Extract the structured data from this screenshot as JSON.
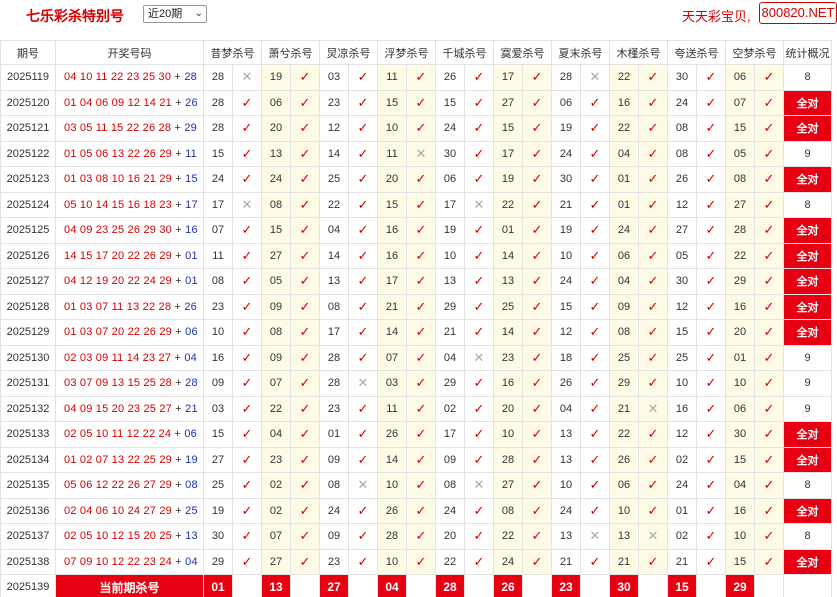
{
  "header": {
    "title": "七乐彩杀特别号",
    "select_value": "近20期",
    "brand_text": "天天彩宝贝,",
    "brand_site": "800820.NET"
  },
  "columns": [
    "期号",
    "开奖号码",
    "昔梦杀号",
    "萧兮杀号",
    "炅凉杀号",
    "浮梦杀号",
    "千城杀号",
    "寞爱杀号",
    "夏末杀号",
    "木槿杀号",
    "夸送杀号",
    "空梦杀号",
    "统计概况"
  ],
  "rows": [
    {
      "period": "2025119",
      "draw": "04 10 11 22 23 25 30",
      "special": "28",
      "kills": [
        [
          "28",
          "x"
        ],
        [
          "19",
          "v"
        ],
        [
          "03",
          "v"
        ],
        [
          "11",
          "v"
        ],
        [
          "26",
          "v"
        ],
        [
          "17",
          "v"
        ],
        [
          "28",
          "x"
        ],
        [
          "22",
          "v"
        ],
        [
          "30",
          "v"
        ],
        [
          "06",
          "v"
        ]
      ],
      "stat": "8"
    },
    {
      "period": "2025120",
      "draw": "01 04 06 09 12 14 21",
      "special": "26",
      "kills": [
        [
          "28",
          "v"
        ],
        [
          "06",
          "v"
        ],
        [
          "23",
          "v"
        ],
        [
          "15",
          "v"
        ],
        [
          "15",
          "v"
        ],
        [
          "27",
          "v"
        ],
        [
          "06",
          "v"
        ],
        [
          "16",
          "v"
        ],
        [
          "24",
          "v"
        ],
        [
          "07",
          "v"
        ]
      ],
      "stat": "全对"
    },
    {
      "period": "2025121",
      "draw": "03 05 11 15 22 26 28",
      "special": "29",
      "kills": [
        [
          "28",
          "v"
        ],
        [
          "20",
          "v"
        ],
        [
          "12",
          "v"
        ],
        [
          "10",
          "v"
        ],
        [
          "24",
          "v"
        ],
        [
          "15",
          "v"
        ],
        [
          "19",
          "v"
        ],
        [
          "22",
          "v"
        ],
        [
          "08",
          "v"
        ],
        [
          "15",
          "v"
        ]
      ],
      "stat": "全对"
    },
    {
      "period": "2025122",
      "draw": "01 05 06 13 22 26 29",
      "special": "11",
      "kills": [
        [
          "15",
          "v"
        ],
        [
          "13",
          "v"
        ],
        [
          "14",
          "v"
        ],
        [
          "11",
          "x"
        ],
        [
          "30",
          "v"
        ],
        [
          "17",
          "v"
        ],
        [
          "24",
          "v"
        ],
        [
          "04",
          "v"
        ],
        [
          "08",
          "v"
        ],
        [
          "05",
          "v"
        ]
      ],
      "stat": "9"
    },
    {
      "period": "2025123",
      "draw": "01 03 08 10 16 21 29",
      "special": "15",
      "kills": [
        [
          "24",
          "v"
        ],
        [
          "24",
          "v"
        ],
        [
          "25",
          "v"
        ],
        [
          "20",
          "v"
        ],
        [
          "06",
          "v"
        ],
        [
          "19",
          "v"
        ],
        [
          "30",
          "v"
        ],
        [
          "01",
          "v"
        ],
        [
          "26",
          "v"
        ],
        [
          "08",
          "v"
        ]
      ],
      "stat": "全对"
    },
    {
      "period": "2025124",
      "draw": "05 10 14 15 16 18 23",
      "special": "17",
      "kills": [
        [
          "17",
          "x"
        ],
        [
          "08",
          "v"
        ],
        [
          "22",
          "v"
        ],
        [
          "15",
          "v"
        ],
        [
          "17",
          "x"
        ],
        [
          "22",
          "v"
        ],
        [
          "21",
          "v"
        ],
        [
          "01",
          "v"
        ],
        [
          "12",
          "v"
        ],
        [
          "27",
          "v"
        ]
      ],
      "stat": "8"
    },
    {
      "period": "2025125",
      "draw": "04 09 23 25 26 29 30",
      "special": "16",
      "kills": [
        [
          "07",
          "v"
        ],
        [
          "15",
          "v"
        ],
        [
          "04",
          "v"
        ],
        [
          "16",
          "v"
        ],
        [
          "19",
          "v"
        ],
        [
          "01",
          "v"
        ],
        [
          "19",
          "v"
        ],
        [
          "24",
          "v"
        ],
        [
          "27",
          "v"
        ],
        [
          "28",
          "v"
        ]
      ],
      "stat": "全对"
    },
    {
      "period": "2025126",
      "draw": "14 15 17 20 22 26 29",
      "special": "01",
      "kills": [
        [
          "11",
          "v"
        ],
        [
          "27",
          "v"
        ],
        [
          "14",
          "v"
        ],
        [
          "16",
          "v"
        ],
        [
          "10",
          "v"
        ],
        [
          "14",
          "v"
        ],
        [
          "10",
          "v"
        ],
        [
          "06",
          "v"
        ],
        [
          "05",
          "v"
        ],
        [
          "22",
          "v"
        ]
      ],
      "stat": "全对"
    },
    {
      "period": "2025127",
      "draw": "04 12 19 20 22 24 29",
      "special": "01",
      "kills": [
        [
          "08",
          "v"
        ],
        [
          "05",
          "v"
        ],
        [
          "13",
          "v"
        ],
        [
          "17",
          "v"
        ],
        [
          "13",
          "v"
        ],
        [
          "13",
          "v"
        ],
        [
          "24",
          "v"
        ],
        [
          "04",
          "v"
        ],
        [
          "30",
          "v"
        ],
        [
          "29",
          "v"
        ]
      ],
      "stat": "全对"
    },
    {
      "period": "2025128",
      "draw": "01 03 07 11 13 22 28",
      "special": "26",
      "kills": [
        [
          "23",
          "v"
        ],
        [
          "09",
          "v"
        ],
        [
          "08",
          "v"
        ],
        [
          "21",
          "v"
        ],
        [
          "29",
          "v"
        ],
        [
          "25",
          "v"
        ],
        [
          "15",
          "v"
        ],
        [
          "09",
          "v"
        ],
        [
          "12",
          "v"
        ],
        [
          "16",
          "v"
        ]
      ],
      "stat": "全对"
    },
    {
      "period": "2025129",
      "draw": "01 03 07 20 22 26 29",
      "special": "06",
      "kills": [
        [
          "10",
          "v"
        ],
        [
          "08",
          "v"
        ],
        [
          "17",
          "v"
        ],
        [
          "14",
          "v"
        ],
        [
          "21",
          "v"
        ],
        [
          "14",
          "v"
        ],
        [
          "12",
          "v"
        ],
        [
          "08",
          "v"
        ],
        [
          "15",
          "v"
        ],
        [
          "20",
          "v"
        ]
      ],
      "stat": "全对"
    },
    {
      "period": "2025130",
      "draw": "02 03 09 11 14 23 27",
      "special": "04",
      "kills": [
        [
          "16",
          "v"
        ],
        [
          "09",
          "v"
        ],
        [
          "28",
          "v"
        ],
        [
          "07",
          "v"
        ],
        [
          "04",
          "x"
        ],
        [
          "23",
          "v"
        ],
        [
          "18",
          "v"
        ],
        [
          "25",
          "v"
        ],
        [
          "25",
          "v"
        ],
        [
          "01",
          "v"
        ]
      ],
      "stat": "9"
    },
    {
      "period": "2025131",
      "draw": "03 07 09 13 15 25 28",
      "special": "28",
      "kills": [
        [
          "09",
          "v"
        ],
        [
          "07",
          "v"
        ],
        [
          "28",
          "x"
        ],
        [
          "03",
          "v"
        ],
        [
          "29",
          "v"
        ],
        [
          "16",
          "v"
        ],
        [
          "26",
          "v"
        ],
        [
          "29",
          "v"
        ],
        [
          "10",
          "v"
        ],
        [
          "10",
          "v"
        ]
      ],
      "stat": "9"
    },
    {
      "period": "2025132",
      "draw": "04 09 15 20 23 25 27",
      "special": "21",
      "kills": [
        [
          "03",
          "v"
        ],
        [
          "22",
          "v"
        ],
        [
          "23",
          "v"
        ],
        [
          "11",
          "v"
        ],
        [
          "02",
          "v"
        ],
        [
          "20",
          "v"
        ],
        [
          "04",
          "v"
        ],
        [
          "21",
          "x"
        ],
        [
          "16",
          "v"
        ],
        [
          "06",
          "v"
        ]
      ],
      "stat": "9"
    },
    {
      "period": "2025133",
      "draw": "02 05 10 11 12 22 24",
      "special": "06",
      "kills": [
        [
          "15",
          "v"
        ],
        [
          "04",
          "v"
        ],
        [
          "01",
          "v"
        ],
        [
          "26",
          "v"
        ],
        [
          "17",
          "v"
        ],
        [
          "10",
          "v"
        ],
        [
          "13",
          "v"
        ],
        [
          "22",
          "v"
        ],
        [
          "12",
          "v"
        ],
        [
          "30",
          "v"
        ]
      ],
      "stat": "全对"
    },
    {
      "period": "2025134",
      "draw": "01 02 07 13 22 25 29",
      "special": "19",
      "kills": [
        [
          "27",
          "v"
        ],
        [
          "23",
          "v"
        ],
        [
          "09",
          "v"
        ],
        [
          "14",
          "v"
        ],
        [
          "09",
          "v"
        ],
        [
          "28",
          "v"
        ],
        [
          "13",
          "v"
        ],
        [
          "26",
          "v"
        ],
        [
          "02",
          "v"
        ],
        [
          "15",
          "v"
        ]
      ],
      "stat": "全对"
    },
    {
      "period": "2025135",
      "draw": "05 06 12 22 26 27 29",
      "special": "08",
      "kills": [
        [
          "25",
          "v"
        ],
        [
          "02",
          "v"
        ],
        [
          "08",
          "x"
        ],
        [
          "10",
          "v"
        ],
        [
          "08",
          "x"
        ],
        [
          "27",
          "v"
        ],
        [
          "10",
          "v"
        ],
        [
          "06",
          "v"
        ],
        [
          "24",
          "v"
        ],
        [
          "04",
          "v"
        ]
      ],
      "stat": "8"
    },
    {
      "period": "2025136",
      "draw": "02 04 06 10 24 27 29",
      "special": "25",
      "kills": [
        [
          "19",
          "v"
        ],
        [
          "02",
          "v"
        ],
        [
          "24",
          "v"
        ],
        [
          "26",
          "v"
        ],
        [
          "24",
          "v"
        ],
        [
          "08",
          "v"
        ],
        [
          "24",
          "v"
        ],
        [
          "10",
          "v"
        ],
        [
          "01",
          "v"
        ],
        [
          "16",
          "v"
        ]
      ],
      "stat": "全对"
    },
    {
      "period": "2025137",
      "draw": "02 05 10 12 15 20 25",
      "special": "13",
      "kills": [
        [
          "30",
          "v"
        ],
        [
          "07",
          "v"
        ],
        [
          "09",
          "v"
        ],
        [
          "28",
          "v"
        ],
        [
          "20",
          "v"
        ],
        [
          "22",
          "v"
        ],
        [
          "13",
          "x"
        ],
        [
          "13",
          "x"
        ],
        [
          "02",
          "v"
        ],
        [
          "10",
          "v"
        ]
      ],
      "stat": "8"
    },
    {
      "period": "2025138",
      "draw": "07 09 10 12 22 23 24",
      "special": "04",
      "kills": [
        [
          "29",
          "v"
        ],
        [
          "27",
          "v"
        ],
        [
          "23",
          "v"
        ],
        [
          "10",
          "v"
        ],
        [
          "22",
          "v"
        ],
        [
          "24",
          "v"
        ],
        [
          "21",
          "v"
        ],
        [
          "21",
          "v"
        ],
        [
          "21",
          "v"
        ],
        [
          "15",
          "v"
        ]
      ],
      "stat": "全对"
    }
  ],
  "current": {
    "period": "2025139",
    "label": "当前期杀号",
    "kills": [
      "01",
      "13",
      "27",
      "04",
      "28",
      "26",
      "23",
      "30",
      "15",
      "29"
    ]
  },
  "symbols": {
    "hit": "✓",
    "miss": "✕"
  },
  "colors": {
    "accent": "#e60012",
    "special": "#1a2fb5",
    "alt_bg": "#fdfbe6"
  }
}
